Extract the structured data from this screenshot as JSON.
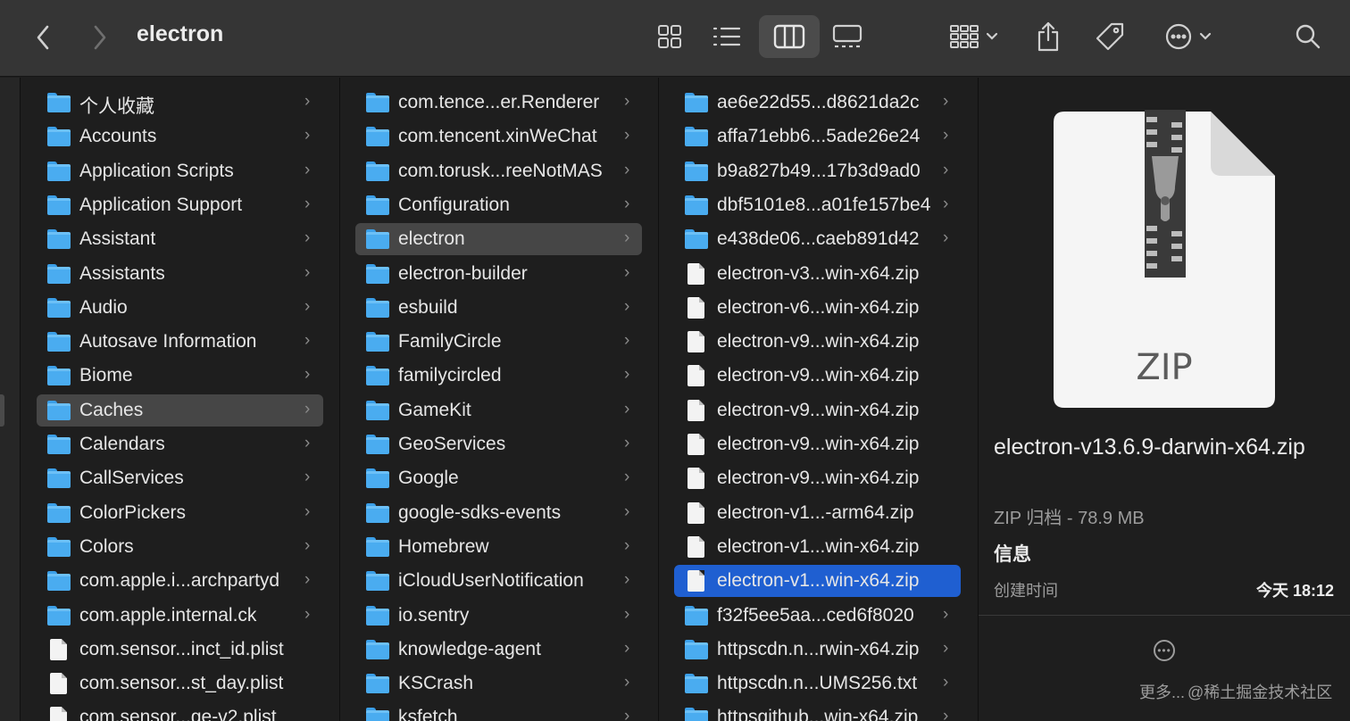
{
  "window": {
    "title": "electron"
  },
  "toolbar": {
    "back": "back-icon",
    "forward": "forward-icon",
    "views": [
      "icon-view",
      "list-view",
      "column-view",
      "gallery-view"
    ],
    "active_view": "column-view"
  },
  "columns": [
    {
      "items": [
        {
          "name": "个人收藏",
          "kind": "folder"
        },
        {
          "name": "Accounts",
          "kind": "folder"
        },
        {
          "name": "Application Scripts",
          "kind": "folder"
        },
        {
          "name": "Application Support",
          "kind": "folder"
        },
        {
          "name": "Assistant",
          "kind": "folder"
        },
        {
          "name": "Assistants",
          "kind": "folder"
        },
        {
          "name": "Audio",
          "kind": "folder"
        },
        {
          "name": "Autosave Information",
          "kind": "folder"
        },
        {
          "name": "Biome",
          "kind": "folder"
        },
        {
          "name": "Caches",
          "kind": "folder",
          "selected": true
        },
        {
          "name": "Calendars",
          "kind": "folder"
        },
        {
          "name": "CallServices",
          "kind": "folder"
        },
        {
          "name": "ColorPickers",
          "kind": "folder"
        },
        {
          "name": "Colors",
          "kind": "folder"
        },
        {
          "name": "com.apple.i...archpartyd",
          "kind": "folder"
        },
        {
          "name": "com.apple.internal.ck",
          "kind": "folder"
        },
        {
          "name": "com.sensor...inct_id.plist",
          "kind": "file"
        },
        {
          "name": "com.sensor...st_day.plist",
          "kind": "file"
        },
        {
          "name": "com.sensor...ge-v2.plist",
          "kind": "file"
        }
      ]
    },
    {
      "items": [
        {
          "name": "com.tence...er.Renderer",
          "kind": "folder"
        },
        {
          "name": "com.tencent.xinWeChat",
          "kind": "folder"
        },
        {
          "name": "com.torusk...reeNotMAS",
          "kind": "folder"
        },
        {
          "name": "Configuration",
          "kind": "folder"
        },
        {
          "name": "electron",
          "kind": "folder",
          "selected": true
        },
        {
          "name": "electron-builder",
          "kind": "folder"
        },
        {
          "name": "esbuild",
          "kind": "folder"
        },
        {
          "name": "FamilyCircle",
          "kind": "folder"
        },
        {
          "name": "familycircled",
          "kind": "folder"
        },
        {
          "name": "GameKit",
          "kind": "folder"
        },
        {
          "name": "GeoServices",
          "kind": "folder"
        },
        {
          "name": "Google",
          "kind": "folder"
        },
        {
          "name": "google-sdks-events",
          "kind": "folder"
        },
        {
          "name": "Homebrew",
          "kind": "folder"
        },
        {
          "name": "iCloudUserNotification",
          "kind": "folder"
        },
        {
          "name": "io.sentry",
          "kind": "folder"
        },
        {
          "name": "knowledge-agent",
          "kind": "folder"
        },
        {
          "name": "KSCrash",
          "kind": "folder"
        },
        {
          "name": "ksfetch",
          "kind": "folder"
        }
      ]
    },
    {
      "items": [
        {
          "name": "ae6e22d55...d8621da2c",
          "kind": "folder"
        },
        {
          "name": "affa71ebb6...5ade26e24",
          "kind": "folder"
        },
        {
          "name": "b9a827b49...17b3d9ad0",
          "kind": "folder"
        },
        {
          "name": "dbf5101e8...a01fe157be4",
          "kind": "folder"
        },
        {
          "name": "e438de06...caeb891d42",
          "kind": "folder"
        },
        {
          "name": "electron-v3...win-x64.zip",
          "kind": "file"
        },
        {
          "name": "electron-v6...win-x64.zip",
          "kind": "file"
        },
        {
          "name": "electron-v9...win-x64.zip",
          "kind": "file"
        },
        {
          "name": "electron-v9...win-x64.zip",
          "kind": "file"
        },
        {
          "name": "electron-v9...win-x64.zip",
          "kind": "file"
        },
        {
          "name": "electron-v9...win-x64.zip",
          "kind": "file"
        },
        {
          "name": "electron-v9...win-x64.zip",
          "kind": "file"
        },
        {
          "name": "electron-v1...-arm64.zip",
          "kind": "file"
        },
        {
          "name": "electron-v1...win-x64.zip",
          "kind": "file"
        },
        {
          "name": "electron-v1...win-x64.zip",
          "kind": "file",
          "selected": true
        },
        {
          "name": "f32f5ee5aa...ced6f8020",
          "kind": "folder"
        },
        {
          "name": "httpscdn.n...rwin-x64.zip",
          "kind": "folder"
        },
        {
          "name": "httpscdn.n...UMS256.txt",
          "kind": "folder"
        },
        {
          "name": "httpsgithub...win-x64.zip",
          "kind": "folder"
        }
      ]
    }
  ],
  "preview": {
    "icon_label": "ZIP",
    "file_name": "electron-v13.6.9-darwin-x64.zip",
    "kind_size": "ZIP 归档 - 78.9 MB",
    "info_heading": "信息",
    "created_label": "创建时间",
    "created_value": "今天 18:12",
    "more_label": "更多...",
    "watermark": "@稀土掘金技术社区"
  },
  "colors": {
    "folder": "#4aacf0",
    "selection_active": "#1f5fd1",
    "selection_inactive": "#464646",
    "toolbar": "#353535",
    "background": "#1e1e1e"
  }
}
